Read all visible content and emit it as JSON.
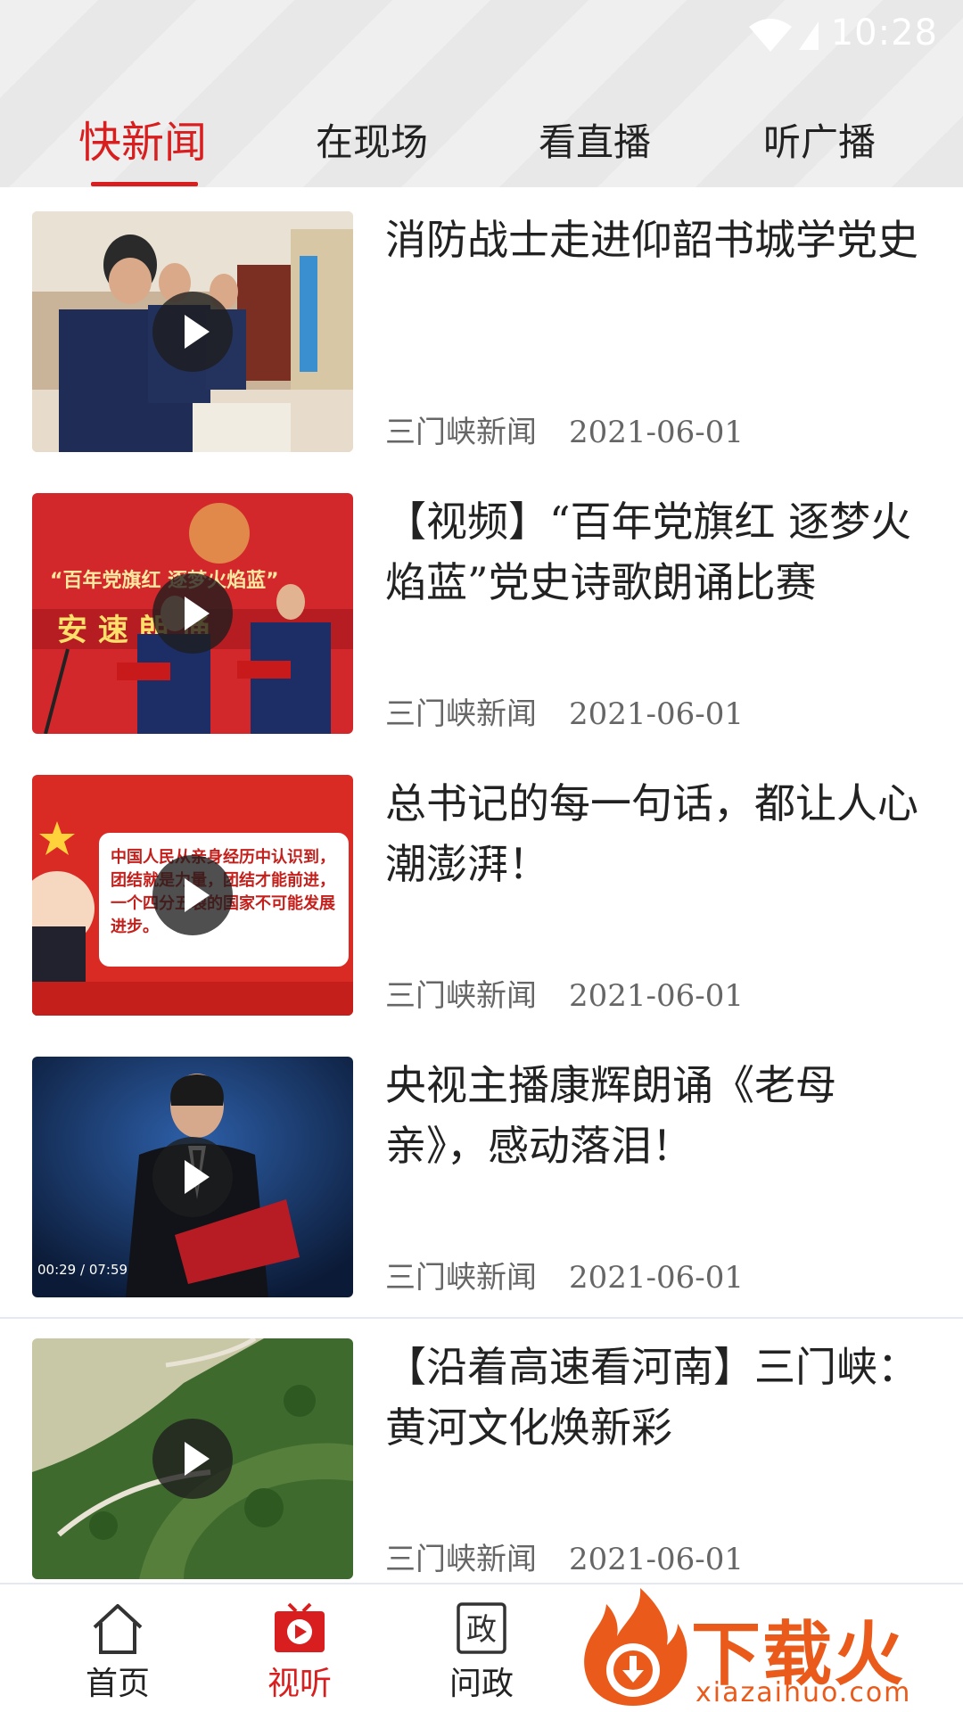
{
  "status_bar": {
    "time": "10:28"
  },
  "tabs": [
    {
      "label": "快新闻",
      "active": true
    },
    {
      "label": "在现场",
      "active": false
    },
    {
      "label": "看直播",
      "active": false
    },
    {
      "label": "听广播",
      "active": false
    }
  ],
  "feed": [
    {
      "title": "消防战士走进仰韶书城学党史",
      "source": "三门峡新闻",
      "date": "2021-06-01"
    },
    {
      "title": "【视频】“百年党旗红 逐梦火焰蓝”党史诗歌朗诵比赛",
      "source": "三门峡新闻",
      "date": "2021-06-01"
    },
    {
      "title": "总书记的每一句话，都让人心潮澎湃！",
      "source": "三门峡新闻",
      "date": "2021-06-01"
    },
    {
      "title": "央视主播康辉朗诵《老母亲》，感动落泪！",
      "source": "三门峡新闻",
      "date": "2021-06-01"
    },
    {
      "title": "【沿着高速看河南】三门峡：黄河文化焕新彩",
      "source": "三门峡新闻",
      "date": "2021-06-01"
    }
  ],
  "thumb_overlays": {
    "item2_banner": "“百年党旗红 逐梦火焰蓝”",
    "item3_quote": "中国人民从亲身经历中认识到，团结就是力量，团结才能前进，一个四分五裂的国家不可能发展进步。",
    "item4_timecode": "00:29 / 07:59"
  },
  "bottom_nav": [
    {
      "label": "首页",
      "icon": "home-icon",
      "active": false
    },
    {
      "label": "视听",
      "icon": "tv-play-icon",
      "active": true
    },
    {
      "label": "问政",
      "icon": "zheng-icon",
      "active": false
    }
  ],
  "watermark": {
    "text": "下载火",
    "url": "xiazaihuo.com"
  },
  "colors": {
    "accent": "#d81e1e",
    "watermark": "#ea5a1a"
  }
}
